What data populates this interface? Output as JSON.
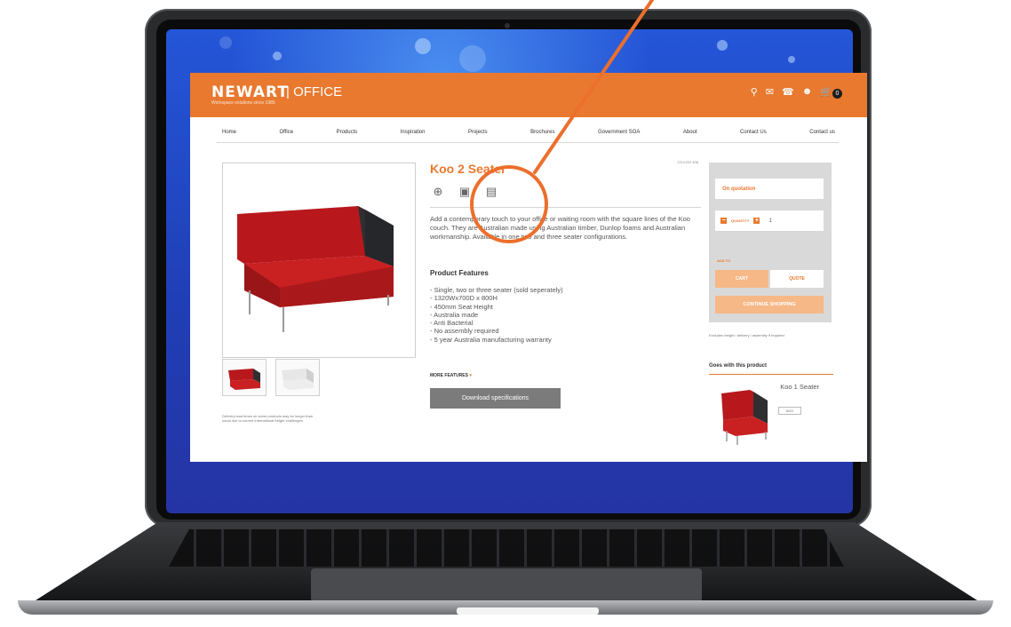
{
  "colors": {
    "brand_orange": "#e8792f",
    "screen_blue": "#2456d8",
    "laptop_body": "#2a2b2d"
  },
  "site": {
    "logo": "NEWART",
    "section": "OFFICE",
    "logo_tagline": "Workspace solutions since 1985",
    "header_icons": [
      "search-icon",
      "mail-icon",
      "phone-icon",
      "user-icon",
      "cart-icon"
    ],
    "cart_count": "0"
  },
  "nav": [
    "Home",
    "Office",
    "Products",
    "Inspiration",
    "Projects",
    "Brochures",
    "Government SOA",
    "About",
    "Contact Us",
    "Contact us"
  ],
  "product": {
    "title": "Koo 2 Seater",
    "code": "CS-KOO 408",
    "action_icons": [
      "zoom-icon",
      "3d-view-icon",
      "brochure-icon"
    ],
    "description": "Add a contemporary touch to your office or waiting room with the square lines of the Koo couch. They are Australian made using Australian timber, Dunlop foams and Australian workmanship. Available in one two and three seater configurations.",
    "features_heading": "Product Features",
    "features": [
      "- Single, two or three seater (sold seperately)",
      "- 1320Wx700D x 800H",
      "- 450mm Seat Height",
      "- Australia made",
      "- Anti Bacterial",
      "- No assembly required",
      "- 5 year Australia manufacturing warranty"
    ],
    "more_features": "MORE FEATURES",
    "download_label": "Download specifications",
    "disclaimer": "Delivery lead times on some products may be longer than usual due to current international freight challenges."
  },
  "sidebar": {
    "price": "On quotation",
    "quantity_label": "QUANTITY",
    "quantity_value": "1",
    "add_to": "ADD TO",
    "cart_label": "CART",
    "quote_label": "QUOTE",
    "continue_label": "CONTINUE SHOPPING",
    "note": "Excludes freight / delivery / assembly if required",
    "goes_with": "Goes with this product",
    "related_name": "Koo 1 Seater",
    "related_add": "ADD"
  }
}
